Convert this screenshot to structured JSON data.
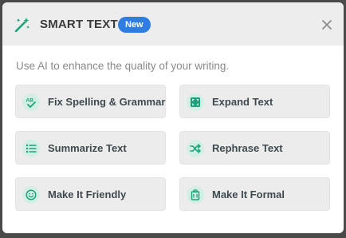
{
  "header": {
    "title": "SMART TEXT",
    "badge": "New",
    "icon": "magic-wand-icon"
  },
  "subtitle": "Use AI to enhance the quality of your writing.",
  "colors": {
    "accent": "#1aa37a",
    "icon_bg": "#d3eee4",
    "badge": "#2f7de1",
    "button_bg": "#ececec",
    "header_bg": "#ededed"
  },
  "actions": [
    {
      "label": "Fix Spelling & Grammar",
      "icon": "spellcheck-icon"
    },
    {
      "label": "Expand Text",
      "icon": "expand-icon"
    },
    {
      "label": "Summarize Text",
      "icon": "list-icon"
    },
    {
      "label": "Rephrase Text",
      "icon": "shuffle-icon"
    },
    {
      "label": "Make It Friendly",
      "icon": "smiley-icon"
    },
    {
      "label": "Make It Formal",
      "icon": "briefcase-icon"
    }
  ]
}
